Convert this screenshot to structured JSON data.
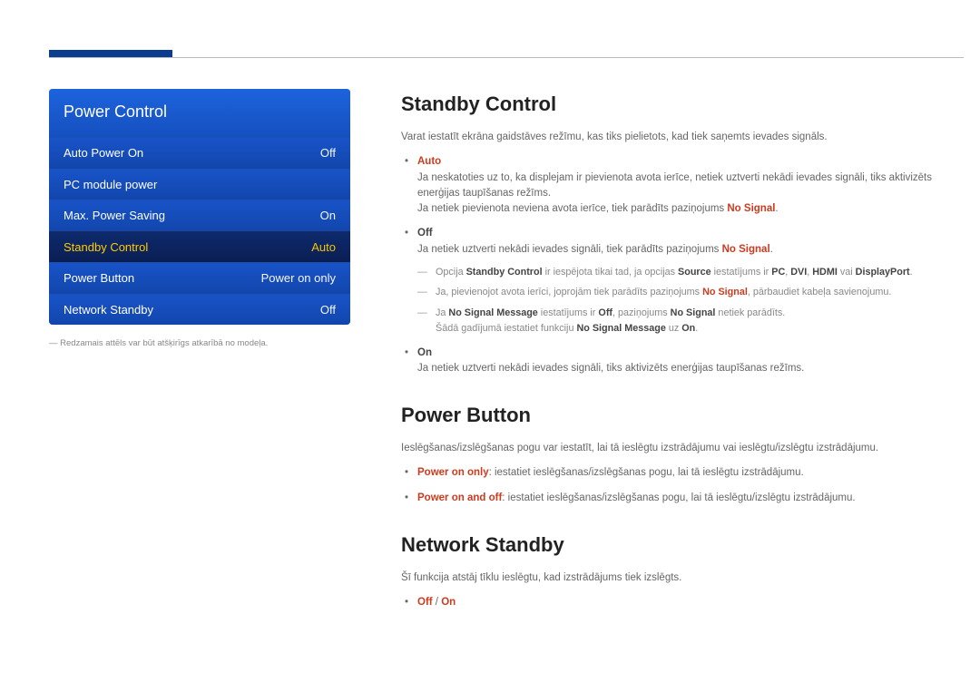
{
  "osd": {
    "title": "Power Control",
    "rows": [
      {
        "label": "Auto Power On",
        "value": "Off",
        "selected": false
      },
      {
        "label": "PC module power",
        "value": "",
        "selected": false
      },
      {
        "label": "Max. Power Saving",
        "value": "On",
        "selected": false
      },
      {
        "label": "Standby Control",
        "value": "Auto",
        "selected": true
      },
      {
        "label": "Power Button",
        "value": "Power on only",
        "selected": false
      },
      {
        "label": "Network Standby",
        "value": "Off",
        "selected": false
      }
    ],
    "note": "Redzamais attēls var būt atšķirīgs atkarībā no modeļa."
  },
  "sections": {
    "standby": {
      "heading": "Standby Control",
      "intro": "Varat iestatīt ekrāna gaidstāves režīmu, kas tiks pielietots, kad tiek saņemts ievades signāls.",
      "auto": {
        "label": "Auto",
        "line1a": "Ja neskatoties uz to, ka displejam ir pievienota avota ierīce, netiek uztverti nekādi ievades signāli, tiks aktivizēts enerģijas taupīšanas režīms.",
        "line2a": "Ja netiek pievienota neviena avota ierīce, tiek parādīts paziņojums ",
        "line2b": "No Signal",
        "line2c": "."
      },
      "off": {
        "label": "Off",
        "line1a": "Ja netiek uztverti nekādi ievades signāli, tiek parādīts paziņojums ",
        "line1b": "No Signal",
        "line1c": ".",
        "sub1_a": "Opcija ",
        "sub1_b": "Standby Control",
        "sub1_c": " ir iespējota tikai tad, ja opcijas ",
        "sub1_d": "Source",
        "sub1_e": " iestatījums ir ",
        "sub1_f": "PC",
        "sub1_g": ", ",
        "sub1_h": "DVI",
        "sub1_i": ", ",
        "sub1_j": "HDMI",
        "sub1_k": " vai ",
        "sub1_l": "DisplayPort",
        "sub1_m": ".",
        "sub2_a": "Ja, pievienojot avota ierīci, joprojām tiek parādīts paziņojums ",
        "sub2_b": "No Signal",
        "sub2_c": ", pārbaudiet kabeļa savienojumu.",
        "sub3_a": "Ja ",
        "sub3_b": "No Signal Message",
        "sub3_c": " iestatījums ir ",
        "sub3_d": "Off",
        "sub3_e": ", paziņojums ",
        "sub3_f": "No Signal",
        "sub3_g": " netiek parādīts.",
        "sub3_h": "Šādā gadījumā iestatiet funkciju ",
        "sub3_i": "No Signal Message",
        "sub3_j": " uz ",
        "sub3_k": "On",
        "sub3_l": "."
      },
      "on": {
        "label": "On",
        "line": "Ja netiek uztverti nekādi ievades signāli, tiks aktivizēts enerģijas taupīšanas režīms."
      }
    },
    "powerbutton": {
      "heading": "Power Button",
      "intro": "Ieslēgšanas/izslēgšanas pogu var iestatīt, lai tā ieslēgtu izstrādājumu vai ieslēgtu/izslēgtu izstrādājumu.",
      "opt1a": "Power on only",
      "opt1b": ": iestatiet ieslēgšanas/izslēgšanas pogu, lai tā ieslēgtu izstrādājumu.",
      "opt2a": "Power on and off",
      "opt2b": ": iestatiet ieslēgšanas/izslēgšanas pogu, lai tā ieslēgtu/izslēgtu izstrādājumu."
    },
    "network": {
      "heading": "Network Standby",
      "intro": "Šī funkcija atstāj tīklu ieslēgtu, kad izstrādājums tiek izslēgts.",
      "opt_off": "Off",
      "sep": " / ",
      "opt_on": "On"
    }
  }
}
